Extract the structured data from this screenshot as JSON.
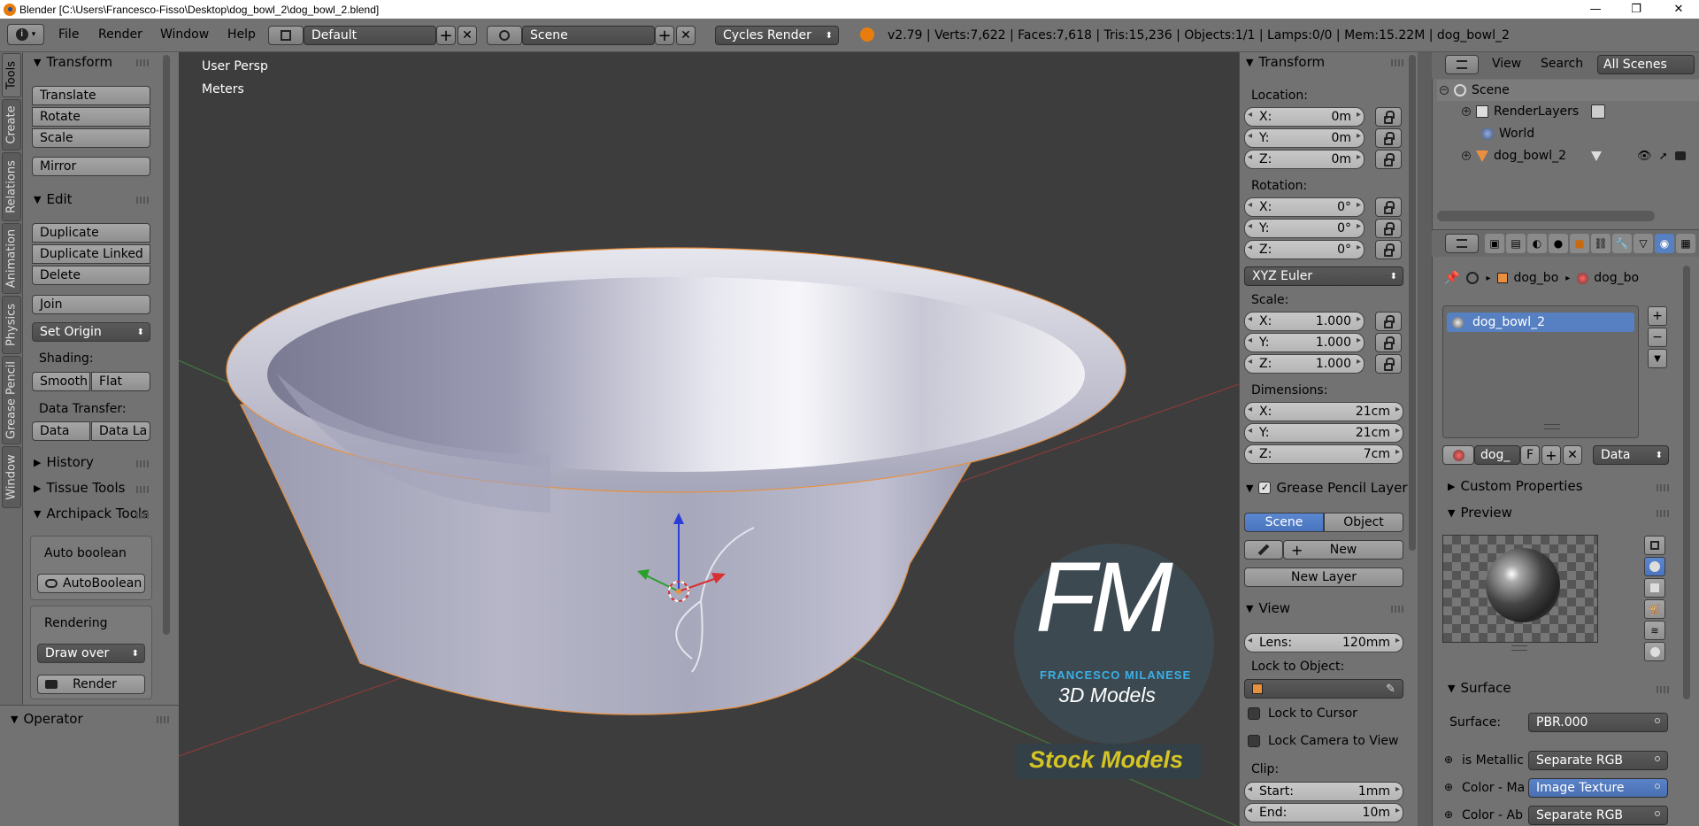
{
  "window": {
    "title": "Blender [C:\\Users\\Francesco-Fisso\\Desktop\\dog_bowl_2\\dog_bowl_2.blend]",
    "minimize": "—",
    "maximize": "❐",
    "close": "✕"
  },
  "info_header": {
    "menus": [
      "File",
      "Render",
      "Window",
      "Help"
    ],
    "screen_layout": "Default",
    "scene": "Scene",
    "render_engine": "Cycles Render",
    "stats": "v2.79 | Verts:7,622 | Faces:7,618 | Tris:15,236 | Objects:1/1 | Lamps:0/0 | Mem:15.22M | dog_bowl_2"
  },
  "tool_tabs": [
    "Tools",
    "Create",
    "Relations",
    "Animation",
    "Physics",
    "Grease Pencil",
    "Window"
  ],
  "toolshelf": {
    "transform_header": "Transform",
    "transform_buttons": [
      "Translate",
      "Rotate",
      "Scale"
    ],
    "mirror": "Mirror",
    "edit_header": "Edit",
    "edit_buttons": [
      "Duplicate",
      "Duplicate Linked",
      "Delete"
    ],
    "join": "Join",
    "set_origin": "Set Origin",
    "shading_label": "Shading:",
    "smooth": "Smooth",
    "flat": "Flat",
    "data_transfer_label": "Data Transfer:",
    "data": "Data",
    "data_layers": "Data La",
    "history": "History",
    "tissue_tools": "Tissue Tools",
    "archipack": "Archipack Tools",
    "auto_boolean_label": "Auto boolean",
    "auto_boolean_button": "AutoBoolean",
    "rendering_label": "Rendering",
    "draw_over": "Draw over",
    "render_button": "Render",
    "operator": "Operator"
  },
  "viewport": {
    "view_name": "User Persp",
    "units": "Meters",
    "watermark_logo": "FM",
    "watermark_name": "FRANCESCO MILANESE",
    "watermark_sub": "3D Models",
    "watermark_stock": "Stock Models"
  },
  "npanel": {
    "transform_header": "Transform",
    "location_label": "Location:",
    "location": [
      {
        "axis": "X:",
        "value": "0m"
      },
      {
        "axis": "Y:",
        "value": "0m"
      },
      {
        "axis": "Z:",
        "value": "0m"
      }
    ],
    "rotation_label": "Rotation:",
    "rotation": [
      {
        "axis": "X:",
        "value": "0°"
      },
      {
        "axis": "Y:",
        "value": "0°"
      },
      {
        "axis": "Z:",
        "value": "0°"
      }
    ],
    "rotation_mode": "XYZ Euler",
    "scale_label": "Scale:",
    "scale": [
      {
        "axis": "X:",
        "value": "1.000"
      },
      {
        "axis": "Y:",
        "value": "1.000"
      },
      {
        "axis": "Z:",
        "value": "1.000"
      }
    ],
    "dimensions_label": "Dimensions:",
    "dimensions": [
      {
        "axis": "X:",
        "value": "21cm"
      },
      {
        "axis": "Y:",
        "value": "21cm"
      },
      {
        "axis": "Z:",
        "value": "7cm"
      }
    ],
    "grease_pencil_header": "Grease Pencil Layer",
    "gp_scene": "Scene",
    "gp_object": "Object",
    "gp_new": "New",
    "gp_new_layer": "New Layer",
    "view_header": "View",
    "lens_label": "Lens:",
    "lens_value": "120mm",
    "lock_to_object_label": "Lock to Object:",
    "lock_to_cursor": "Lock to Cursor",
    "lock_camera": "Lock Camera to View",
    "clip_label": "Clip:",
    "clip_start_label": "Start:",
    "clip_start": "1mm",
    "clip_end_label": "End:",
    "clip_end": "10m"
  },
  "outliner": {
    "view": "View",
    "search": "Search",
    "display_mode": "All Scenes",
    "items": [
      "Scene",
      "RenderLayers",
      "World",
      "dog_bowl_2"
    ]
  },
  "properties": {
    "breadcrumb_object": "dog_bo",
    "breadcrumb_material": "dog_bo",
    "material_slot": "dog_bowl_2",
    "material_name": "dog_",
    "fake_user": "F",
    "link_mode": "Data",
    "custom_properties": "Custom Properties",
    "preview": "Preview",
    "surface_header": "Surface",
    "surface_label": "Surface:",
    "surface_value": "PBR.000",
    "inputs": [
      {
        "label": "is Metallic",
        "value": "Separate RGB"
      },
      {
        "label": "Color - Ma",
        "value": "Image Texture"
      },
      {
        "label": "Color - Ab",
        "value": "Separate RGB"
      }
    ]
  },
  "colors": {
    "header_bg": "#727272",
    "viewport_bg": "#3d3d3d",
    "accent_blue": "#5680c2",
    "selection_orange": "#f0a050"
  }
}
